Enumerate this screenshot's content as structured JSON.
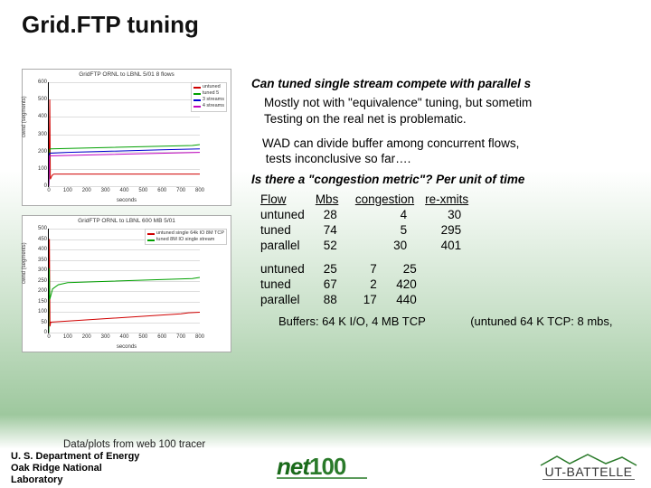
{
  "title": "Grid.FTP tuning",
  "question1": "Can tuned single stream compete with parallel s",
  "answer1a": "Mostly not with \"equivalence\" tuning, but sometim",
  "answer1b": "Testing on the real net is problematic.",
  "note1a": "WAD can divide buffer among concurrent flows,",
  "note1b": "tests inconclusive so far….",
  "question2": "Is there a \"congestion metric\"?  Per unit of time",
  "table_header": {
    "c0": "Flow",
    "c1": "Mbs",
    "c2": "congestion",
    "c3": "re-xmits"
  },
  "set1": [
    {
      "flow": "untuned",
      "mbs": "28",
      "cong": "4",
      "rex": "30"
    },
    {
      "flow": "tuned",
      "mbs": "74",
      "cong": "5",
      "rex": "295"
    },
    {
      "flow": "parallel",
      "mbs": "52",
      "cong": "30",
      "rex": "401"
    }
  ],
  "set2": [
    {
      "flow": "untuned",
      "mbs": "25",
      "cong": "7",
      "rex": "25"
    },
    {
      "flow": "tuned",
      "mbs": "67",
      "cong": "2",
      "rex": "420"
    },
    {
      "flow": "parallel",
      "mbs": "88",
      "cong": "17",
      "rex": "440"
    }
  ],
  "buffers_label": "Buffers: 64 K I/O,  4 MB TCP",
  "untuned_note": "(untuned 64 K TCP: 8 mbs,",
  "caption": "Data/plots from web 100 tracer",
  "affil_l1": "U. S. Department of Energy",
  "affil_l2": "Oak Ridge National",
  "affil_l3": "Laboratory",
  "net100_a": "net",
  "net100_b": "100",
  "utb": "UT-BATTELLE",
  "chart_data": [
    {
      "type": "line",
      "title": "GridFTP ORNL to LBNL 5/01 8 flows",
      "xlabel": "seconds",
      "ylabel": "cwnd (segments)",
      "xlim": [
        0,
        800
      ],
      "ylim": [
        0,
        600
      ],
      "xticks": [
        0,
        100,
        200,
        300,
        400,
        500,
        600,
        700,
        800
      ],
      "yticks": [
        0,
        100,
        200,
        300,
        400,
        500,
        600
      ],
      "legend": [
        "untuned",
        "tuned 5",
        "3 streams",
        "4 streams"
      ],
      "colors": [
        "#d00000",
        "#00a000",
        "#0000d0",
        "#c000c0"
      ],
      "series": [
        {
          "name": "untuned",
          "x": [
            0,
            5,
            8,
            12,
            16,
            20,
            24,
            28,
            800
          ],
          "y": [
            0,
            500,
            40,
            50,
            60,
            65,
            68,
            70,
            70
          ]
        },
        {
          "name": "tuned 5",
          "x": [
            0,
            4,
            8,
            760,
            800
          ],
          "y": [
            0,
            210,
            215,
            235,
            240
          ]
        },
        {
          "name": "3 streams",
          "x": [
            0,
            3,
            100,
            600,
            800
          ],
          "y": [
            0,
            190,
            195,
            210,
            215
          ]
        },
        {
          "name": "4 streams",
          "x": [
            0,
            3,
            200,
            800
          ],
          "y": [
            0,
            175,
            180,
            195
          ]
        }
      ]
    },
    {
      "type": "line",
      "title": "GridFTP ORNL to LBNL 600 MB 5/01",
      "xlabel": "seconds",
      "ylabel": "cwnd (segments)",
      "xlim": [
        0,
        800
      ],
      "ylim": [
        0,
        500
      ],
      "xticks": [
        0,
        100,
        200,
        300,
        400,
        500,
        600,
        700,
        800
      ],
      "yticks": [
        0,
        50,
        100,
        150,
        200,
        250,
        300,
        350,
        400,
        450,
        500
      ],
      "legend": [
        "untuned single 64k IO 8M TCP",
        "tuned 8M IO single stream"
      ],
      "colors": [
        "#d00000",
        "#00a000"
      ],
      "series": [
        {
          "name": "untuned single 64k IO 8M TCP",
          "x": [
            0,
            3,
            6,
            10,
            700,
            740,
            800
          ],
          "y": [
            0,
            450,
            30,
            50,
            90,
            95,
            98
          ]
        },
        {
          "name": "tuned 8M IO single stream",
          "x": [
            0,
            2,
            5,
            20,
            50,
            100,
            760,
            800
          ],
          "y": [
            0,
            310,
            160,
            210,
            230,
            240,
            260,
            265
          ]
        }
      ]
    }
  ]
}
